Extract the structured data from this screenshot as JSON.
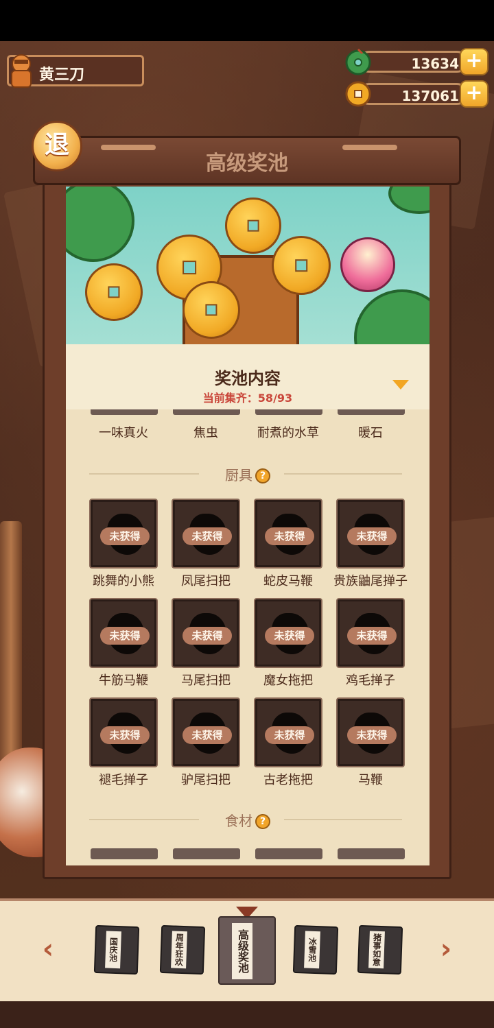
{
  "player": {
    "name": "黄三刀"
  },
  "currencies": [
    {
      "icon": "jade-icon",
      "value": "13634",
      "color": "#3f9b4d"
    },
    {
      "icon": "coin-icon",
      "value": "137061",
      "color": "#f1a925"
    }
  ],
  "header": {
    "title": "高级奖池",
    "exit_label": "退"
  },
  "pool": {
    "title": "奖池内容",
    "progress": "当前集齐：58/93"
  },
  "top_row": [
    "一味真火",
    "焦虫",
    "耐煮的水草",
    "暖石"
  ],
  "sections": [
    {
      "title": "厨具",
      "locked_label": "未获得",
      "items": [
        "跳舞的小熊",
        "凤尾扫把",
        "蛇皮马鞭",
        "贵族鼬尾掸子",
        "牛筋马鞭",
        "马尾扫把",
        "魔女拖把",
        "鸡毛掸子",
        "褪毛掸子",
        "驴尾扫把",
        "古老拖把",
        "马鞭"
      ]
    },
    {
      "title": "食材"
    }
  ],
  "bottom_nav": {
    "prev_label": "‹",
    "next_label": "›",
    "books": [
      "国庆池",
      "周年狂欢",
      "高级奖池",
      "冰雪池",
      "猪事如意"
    ],
    "active_index": 2
  }
}
